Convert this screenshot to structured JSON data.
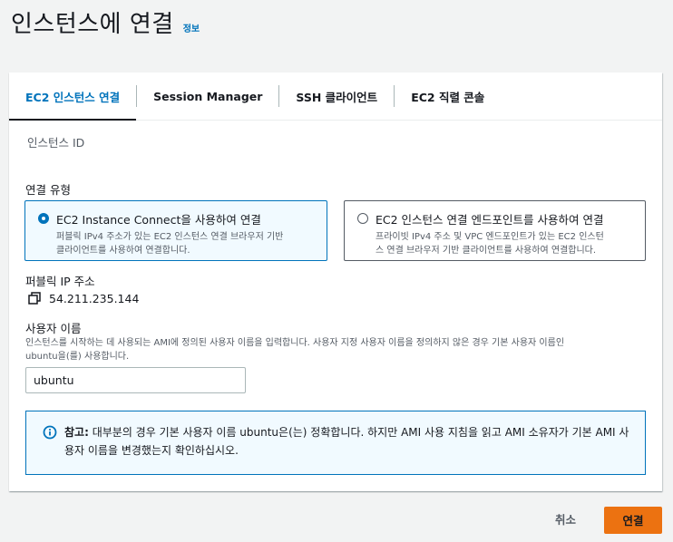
{
  "header": {
    "title": "인스턴스에 연결",
    "info_link": "정보"
  },
  "tabs": [
    {
      "label": "EC2 인스턴스 연결",
      "active": true
    },
    {
      "label": "Session Manager",
      "active": false
    },
    {
      "label": "SSH 클라이언트",
      "active": false
    },
    {
      "label": "EC2 직렬 콘솔",
      "active": false
    }
  ],
  "form": {
    "instance_id_label": "인스턴스 ID",
    "connection_type_label": "연결 유형",
    "options": [
      {
        "title": "EC2 Instance Connect을 사용하여 연결",
        "desc_line1": "퍼블릭 IPv4 주소가 있는 EC2 인스턴스 연결 브라우저 기반",
        "desc_line2": "클라이언트를 사용하여 연결합니다.",
        "selected": true
      },
      {
        "title": "EC2 인스턴스 연결 엔드포인트를 사용하여 연결",
        "desc_line1": "프라이빗 IPv4 주소 및 VPC 엔드포인트가 있는 EC2 인스턴",
        "desc_line2": "스 연결 브라우저 기반 클라이언트를 사용하여 연결합니다.",
        "selected": false
      }
    ],
    "public_ip_label": "퍼블릭 IP 주소",
    "public_ip_value": "54.211.235.144",
    "username_label": "사용자 이름",
    "username_hint_line1": "인스턴스를 시작하는 데 사용되는 AMI에 정의된 사용자 이름을 입력합니다. 사용자 지정 사용자 이름을 정의하지 않은 경우 기본 사용자 이름인",
    "username_hint_line2": "ubuntu을(를) 사용합니다.",
    "username_value": "ubuntu"
  },
  "alert": {
    "bold": "참고:",
    "text": " 대부분의 경우 기본 사용자 이름 ubuntu은(는) 정확합니다. 하지만 AMI 사용 지침을 읽고 AMI 소유자가 기본 AMI 사용자 이름을 변경했는지 확인하십시오."
  },
  "footer": {
    "cancel_label": "취소",
    "connect_label": "연결"
  },
  "colors": {
    "accent": "#0073bb",
    "primary_button": "#ec7211",
    "page_bg": "#f2f3f3"
  },
  "icons": [
    "copy-icon",
    "info-icon"
  ]
}
